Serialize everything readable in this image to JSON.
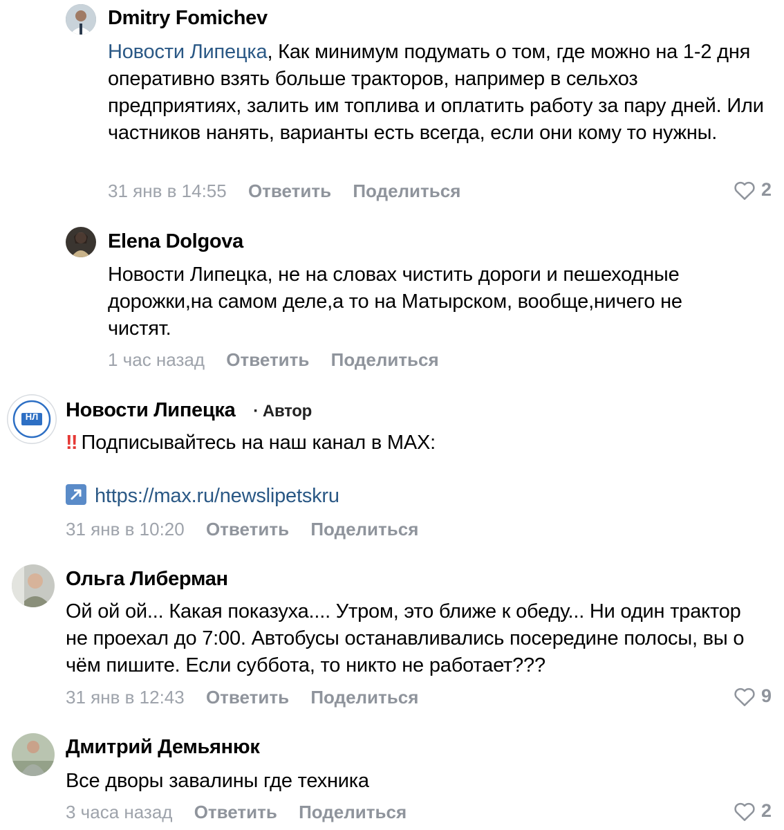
{
  "comments": [
    {
      "name": "Dmitry Fomichev",
      "mention": "Новости Липецка",
      "text": ", Как минимум подумать о том, где можно на 1-2 дня оперативно взять больше тракторов, например в сельхоз предприятиях, залить им топлива и оплатить работу за пару дней. Или частников нанять, варианты есть всегда, если они кому то нужны.",
      "time": "31 янв в 14:55",
      "reply": "Ответить",
      "share": "Поделиться",
      "likes": "2"
    },
    {
      "name": "Elena Dolgova",
      "text": "Новости Липецка, не на словах чистить дороги и пешеходные дорожки,на самом деле,а то на Матырском, вообще,ничего не чистят.",
      "time": "1 час назад",
      "reply": "Ответить",
      "share": "Поделиться"
    },
    {
      "name": "Новости Липецка",
      "author_tag": "Автор",
      "author_dot": "·",
      "avatar_text": "НЛ",
      "exclamation": "‼",
      "text": "Подписывайтесь на наш канал в MAX:",
      "link": "https://max.ru/newslipetskru",
      "time": "31 янв в 10:20",
      "reply": "Ответить",
      "share": "Поделиться"
    },
    {
      "name": "Ольга Либерман",
      "text": "Ой ой ой... Какая показуха.... Утром, это ближе к обеду... Ни один трактор не проехал до 7:00. Автобусы останавливались посередине полосы, вы о чём пишите. Если суббота, то никто не работает???",
      "time": "31 янв в 12:43",
      "reply": "Ответить",
      "share": "Поделиться",
      "likes": "9"
    },
    {
      "name": "Дмитрий Демьянюк",
      "text": "Все дворы завалины где техника",
      "time": "3 часа назад",
      "reply": "Ответить",
      "share": "Поделиться",
      "likes": "2"
    }
  ],
  "colors": {
    "link": "#2a5885",
    "meta": "#9ea3ab",
    "accent_blue": "#2d6fc4"
  },
  "icons": [
    "heart-icon",
    "external-link-icon",
    "double-exclamation-icon"
  ]
}
